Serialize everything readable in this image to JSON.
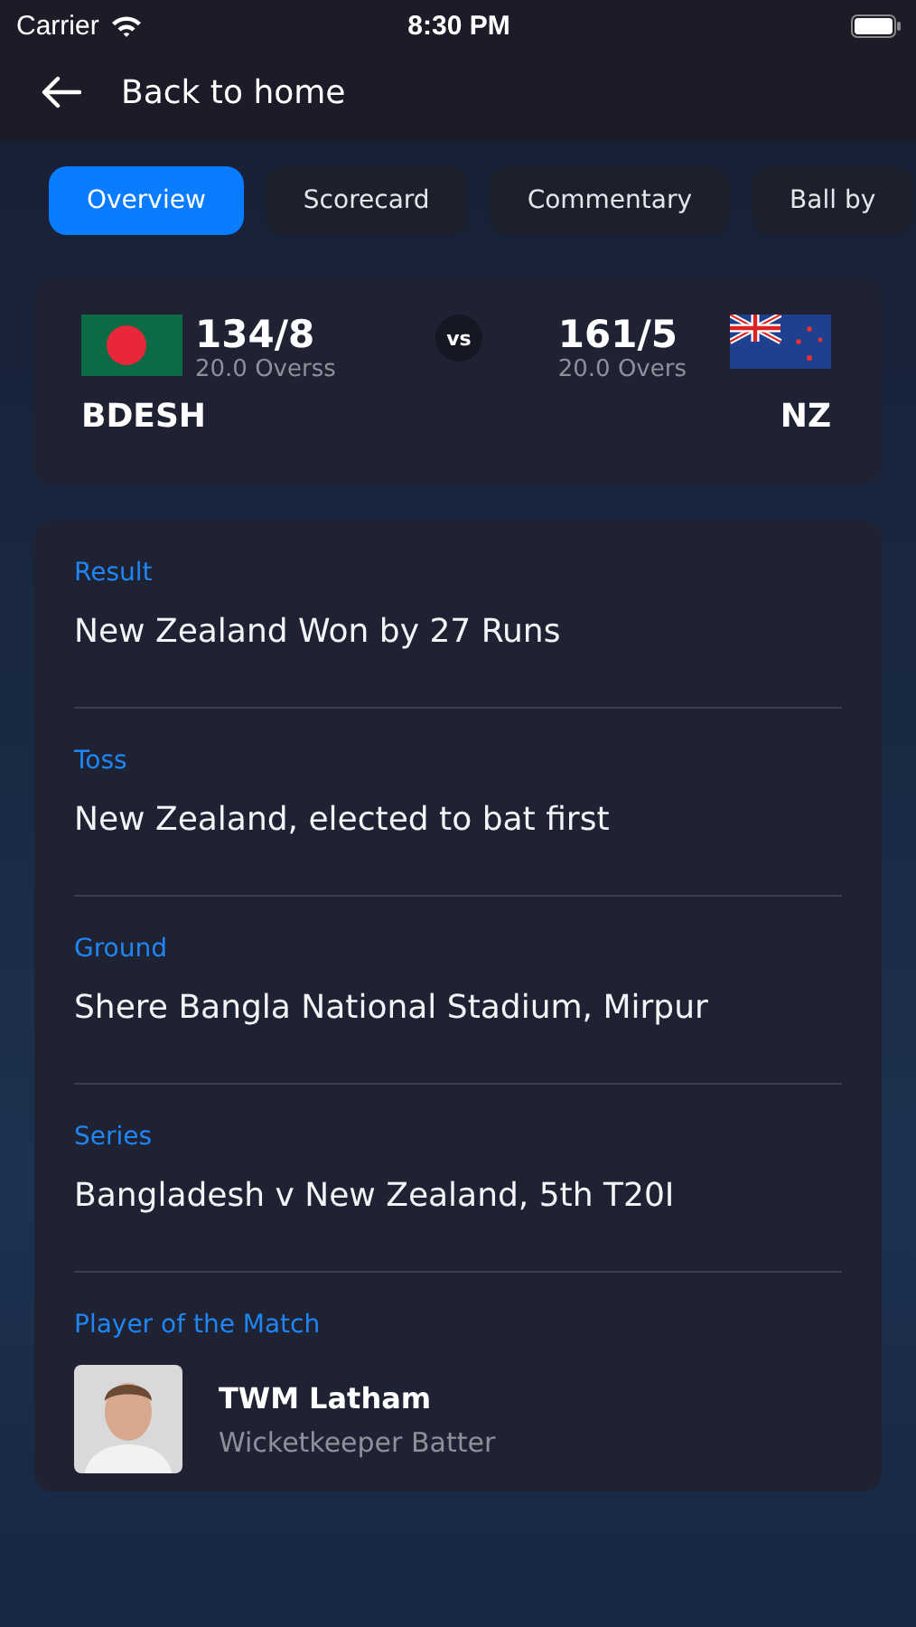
{
  "status_bar": {
    "carrier": "Carrier",
    "time": "8:30 PM"
  },
  "nav": {
    "back_label": "Back to home"
  },
  "tabs": [
    {
      "label": "Overview",
      "selected": true
    },
    {
      "label": "Scorecard",
      "selected": false
    },
    {
      "label": "Commentary",
      "selected": false
    },
    {
      "label": "Ball by",
      "selected": false
    }
  ],
  "score": {
    "vs": "vs",
    "teams": [
      {
        "kind": "bangladesh",
        "score": "134/8",
        "overs": "20.0 Overss",
        "name": "BDESH"
      },
      {
        "kind": "new_zealand",
        "score": "161/5",
        "overs": "20.0 Overs",
        "name": "NZ"
      }
    ]
  },
  "sections": [
    {
      "kind": "text",
      "label": "Result",
      "value": "New Zealand Won by 27 Runs"
    },
    {
      "kind": "text",
      "label": "Toss",
      "value": "New Zealand, elected to bat first"
    },
    {
      "kind": "text",
      "label": "Ground",
      "value": "Shere Bangla National Stadium, Mirpur"
    },
    {
      "kind": "text",
      "label": "Series",
      "value": "Bangladesh v New Zealand, 5th T20I"
    },
    {
      "kind": "player",
      "label": "Player of the Match",
      "name": "TWM Latham",
      "role": "Wicketkeeper Batter"
    }
  ]
}
